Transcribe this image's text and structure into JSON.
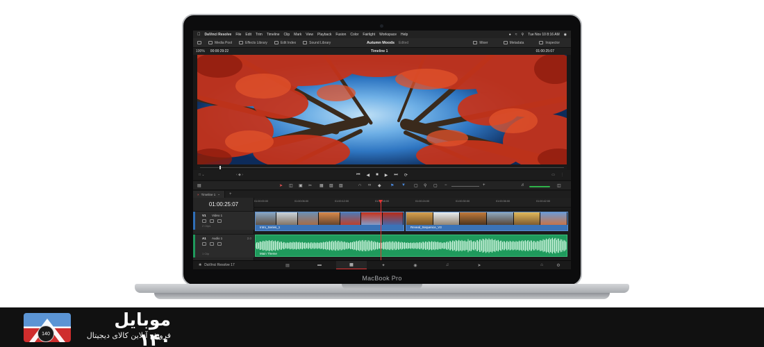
{
  "menubar": {
    "apple_icon": "apple-icon",
    "app_name": "DaVinci Resolve",
    "items": [
      "File",
      "Edit",
      "Trim",
      "Timeline",
      "Clip",
      "Mark",
      "View",
      "Playback",
      "Fusion",
      "Color",
      "Fairlight",
      "Workspace",
      "Help"
    ],
    "clock": "Tue Nov 10  8:16 AM"
  },
  "toolbar": {
    "media_pool": "Media Pool",
    "effects_library": "Effects Library",
    "edit_index": "Edit Index",
    "sound_library": "Sound Library",
    "project_name": "Autumn Moods",
    "project_status": "Edited",
    "mixer": "Mixer",
    "metadata": "Metadata",
    "inspector": "Inspector"
  },
  "viewer": {
    "zoom": "100%",
    "source_timecode": "00:00:29:22",
    "timeline_name": "Timeline 1",
    "record_timecode": "01:00:25:07"
  },
  "timeline": {
    "tab_label": "Timeline 1",
    "current_timecode": "01:00:25:07",
    "ruler_ticks": [
      "01:00:00:00",
      "01:00:06:00",
      "01:00:12:00",
      "01:00:18:00",
      "01:00:24:00",
      "01:00:30:00",
      "01:00:36:00",
      "01:00:42:00"
    ],
    "video_track": {
      "id": "V1",
      "name": "Video 1",
      "clip_count": "2 Clips"
    },
    "audio_track": {
      "id": "A1",
      "name": "Audio 1",
      "gain": "2.0",
      "clip_count": "1 Clip"
    },
    "video_clips": [
      {
        "name": "Intro_Series_1"
      },
      {
        "name": "Reveal_Sequence_V3"
      }
    ],
    "audio_clip": {
      "name": "Main Theme"
    },
    "playhead_fraction": 0.5
  },
  "pagebar": {
    "brand": "DaVinci Resolve 17",
    "pages": [
      "media",
      "cut",
      "edit",
      "fusion",
      "color",
      "fairlight",
      "deliver"
    ],
    "active_page": "edit"
  },
  "laptop": {
    "label": "MacBook Pro"
  },
  "footer": {
    "title": "موبایل ۱۴۰",
    "subtitle": "فروش آنلاین کالای دیجیتال",
    "badge": "140"
  },
  "colors": {
    "accent_red": "#e53333",
    "video_clip_blue": "#3b73b7",
    "audio_clip_green": "#1f9a5c"
  }
}
